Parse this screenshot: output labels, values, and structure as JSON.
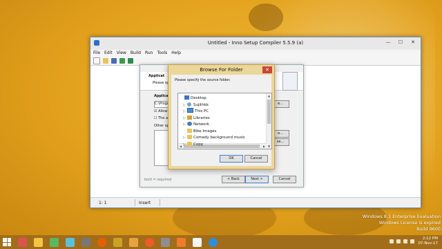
{
  "main_window": {
    "title": "Untitled - Inno Setup Compiler 5.5.9 (a)",
    "menu": [
      "File",
      "Edit",
      "View",
      "Build",
      "Run",
      "Tools",
      "Help"
    ],
    "status": {
      "position": "1:  1",
      "mode": "Insert"
    }
  },
  "wizard": {
    "title": "Inno Setup Script Wizard",
    "header_title": "Applicat",
    "header_desc": "Please sp",
    "section_label": "Applica",
    "folder_value": "C:\\Progr",
    "checkbox_allow": "Allow",
    "checkbox_the": "The a",
    "other_label": "Other ap",
    "browse_partial": "e...",
    "browse2_partial": "se...",
    "footer_note": "bold = required",
    "back_label": "< Back",
    "next_label": "Next >",
    "cancel_label": "Cancel"
  },
  "dialog": {
    "title": "Browse For Folder",
    "close_label": "✕",
    "prompt": "Please specify the source folder.",
    "tree": [
      {
        "label": "Desktop",
        "icon": "desktop",
        "indent": 0,
        "expandable": false
      },
      {
        "label": "Sujithkk",
        "icon": "user",
        "indent": 1,
        "expandable": true
      },
      {
        "label": "This PC",
        "icon": "pc",
        "indent": 1,
        "expandable": true
      },
      {
        "label": "Libraries",
        "icon": "library",
        "indent": 1,
        "expandable": true
      },
      {
        "label": "Network",
        "icon": "network",
        "indent": 1,
        "expandable": true
      },
      {
        "label": "Bike Images",
        "icon": "folder",
        "indent": 1,
        "expandable": false
      },
      {
        "label": "Comedy background music",
        "icon": "folder",
        "indent": 1,
        "expandable": true
      },
      {
        "label": "Copy",
        "icon": "folder",
        "indent": 1,
        "expandable": true
      }
    ],
    "ok_label": "OK",
    "cancel_label": "Cancel"
  },
  "desktop_watermark": {
    "line1": "Windows 8.1 Enterprise Evaluation",
    "line2": "Windows License is expired",
    "line3": "Build 9600"
  },
  "tray": {
    "time": "2:12 PM",
    "date": "07-Nov-17"
  },
  "colors": {
    "accent": "#3c7fd6",
    "close": "#c7463a",
    "desktop": "#e2a11c",
    "taskbar": "#a26d1a"
  }
}
